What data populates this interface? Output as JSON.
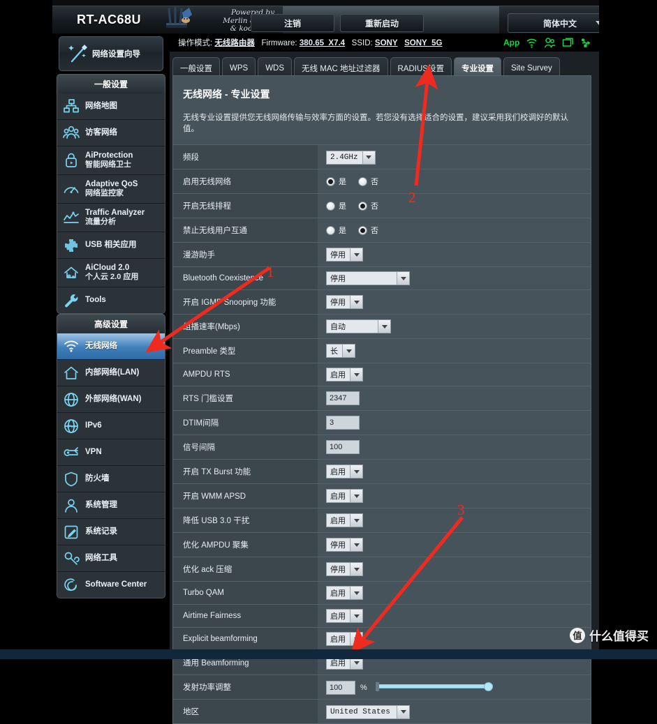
{
  "window": {
    "model": "RT-AC68U",
    "powered_by_line1": "Powered by",
    "powered_by_line2": "Merlin & Vortex",
    "powered_by_line3": "& koolshare",
    "logout_label": "注销",
    "reboot_label": "重新启动",
    "language": "简体中文"
  },
  "info": {
    "op_mode_label": "操作模式:",
    "op_mode_value": "无线路由器",
    "firmware_label": "Firmware:",
    "firmware_value": "380.65_X7.4",
    "ssid_label": "SSID:",
    "ssid_24": "SONY",
    "ssid_5g": "SONY_5G",
    "app_label": "App",
    "icons": [
      "wifi-icon",
      "guest-users-icon",
      "monitor-icon",
      "usb-icon"
    ]
  },
  "sidebar": {
    "wizard_label": "网络设置向导",
    "general_header": "一般设置",
    "general_items": [
      {
        "label": "网络地图",
        "sub": "",
        "icon": "network-map-icon"
      },
      {
        "label": "访客网络",
        "sub": "",
        "icon": "guest-network-icon"
      },
      {
        "label": "AiProtection",
        "sub": "智能网络卫士",
        "icon": "shield-lock-icon"
      },
      {
        "label": "Adaptive QoS",
        "sub": "网络监控家",
        "icon": "gauge-icon"
      },
      {
        "label": "Traffic Analyzer",
        "sub": "流量分析",
        "icon": "chart-line-icon"
      },
      {
        "label": "USB 相关应用",
        "sub": "",
        "icon": "puzzle-icon"
      },
      {
        "label": "AiCloud 2.0",
        "sub": "个人云 2.0 应用",
        "icon": "cloud-house-icon"
      },
      {
        "label": "Tools",
        "sub": "",
        "icon": "wrench-icon"
      }
    ],
    "advanced_header": "高级设置",
    "advanced_items": [
      {
        "label": "无线网络",
        "sub": "",
        "icon": "wifi-icon",
        "active": true
      },
      {
        "label": "内部网络(LAN)",
        "sub": "",
        "icon": "home-icon"
      },
      {
        "label": "外部网络(WAN)",
        "sub": "",
        "icon": "globe-icon"
      },
      {
        "label": "IPv6",
        "sub": "",
        "icon": "ipv6-globe-icon"
      },
      {
        "label": "VPN",
        "sub": "",
        "icon": "vpn-key-icon"
      },
      {
        "label": "防火墙",
        "sub": "",
        "icon": "firewall-shield-icon"
      },
      {
        "label": "系统管理",
        "sub": "",
        "icon": "admin-user-icon"
      },
      {
        "label": "系统记录",
        "sub": "",
        "icon": "log-pencil-icon"
      },
      {
        "label": "网络工具",
        "sub": "",
        "icon": "network-tools-icon"
      },
      {
        "label": "Software Center",
        "sub": "",
        "icon": "software-center-icon"
      }
    ]
  },
  "tabs": [
    {
      "label": "一般设置",
      "active": false
    },
    {
      "label": "WPS",
      "active": false
    },
    {
      "label": "WDS",
      "active": false
    },
    {
      "label": "无线 MAC 地址过滤器",
      "active": false
    },
    {
      "label": "RADIUS设置",
      "active": false
    },
    {
      "label": "专业设置",
      "active": true
    },
    {
      "label": "Site Survey",
      "active": false
    }
  ],
  "page": {
    "title": "无线网络 - 专业设置",
    "description": "无线专业设置提供您无线网络传输与效率方面的设置。若您没有选择适合的设置，建议采用我们校调好的默认值。"
  },
  "form": {
    "radio_yes": "是",
    "radio_no": "否",
    "rows": [
      {
        "key": "频段",
        "type": "select",
        "value": "2.4GHz",
        "width": "narrow"
      },
      {
        "key": "启用无线网络",
        "type": "radio",
        "selected": "yes"
      },
      {
        "key": "开启无线排程",
        "type": "radio",
        "selected": "no"
      },
      {
        "key": "禁止无线用户互通",
        "type": "radio",
        "selected": "no"
      },
      {
        "key": "漫游助手",
        "type": "select",
        "value": "停用",
        "width": "narrow"
      },
      {
        "key": "Bluetooth Coexistence",
        "type": "select",
        "value": "停用",
        "width": "wider"
      },
      {
        "key": "开启 IGMP Snooping 功能",
        "type": "select",
        "value": "停用",
        "width": "narrow"
      },
      {
        "key": "组播速率(Mbps)",
        "type": "select",
        "value": "自动",
        "width": "wide"
      },
      {
        "key": "Preamble 类型",
        "type": "select",
        "value": "长",
        "width": "narrow"
      },
      {
        "key": "AMPDU RTS",
        "type": "select",
        "value": "启用",
        "width": "narrow"
      },
      {
        "key": "RTS 门槛设置",
        "type": "text",
        "value": "2347"
      },
      {
        "key": "DTIM间隔",
        "type": "text",
        "value": "3"
      },
      {
        "key": "信号间隔",
        "type": "text",
        "value": "100"
      },
      {
        "key": "开启 TX Burst 功能",
        "type": "select",
        "value": "启用",
        "width": "narrow"
      },
      {
        "key": "开启 WMM APSD",
        "type": "select",
        "value": "启用",
        "width": "narrow"
      },
      {
        "key": "降低 USB 3.0 干扰",
        "type": "select",
        "value": "启用",
        "width": "narrow"
      },
      {
        "key": "优化 AMPDU 聚集",
        "type": "select",
        "value": "停用",
        "width": "narrow"
      },
      {
        "key": "优化 ack 压缩",
        "type": "select",
        "value": "停用",
        "width": "narrow"
      },
      {
        "key": "Turbo QAM",
        "type": "select",
        "value": "启用",
        "width": "narrow"
      },
      {
        "key": "Airtime Fairness",
        "type": "select",
        "value": "启用",
        "width": "narrow"
      },
      {
        "key": "Explicit beamforming",
        "type": "select",
        "value": "启用",
        "width": "narrow"
      },
      {
        "key": "通用 Beamforming",
        "type": "select",
        "value": "启用",
        "width": "narrow"
      },
      {
        "key": "发射功率调整",
        "type": "power",
        "value": "100",
        "unit": "%",
        "slider_percent": 100
      },
      {
        "key": "地区",
        "type": "select",
        "value": "United States",
        "width": "wider"
      }
    ]
  },
  "annotations": [
    {
      "label": "1",
      "color": "#ef2b20"
    },
    {
      "label": "2",
      "color": "#ef2b20"
    },
    {
      "label": "3",
      "color": "#ef2b20"
    }
  ],
  "watermark": {
    "badge": "值",
    "text": "什么值得买"
  },
  "colors": {
    "accent_blue": "#3f7fba",
    "panel_bg": "#47535b",
    "label_bg": "#3b464d",
    "green_icon": "#19d642",
    "annotation_red": "#ef2b20"
  }
}
